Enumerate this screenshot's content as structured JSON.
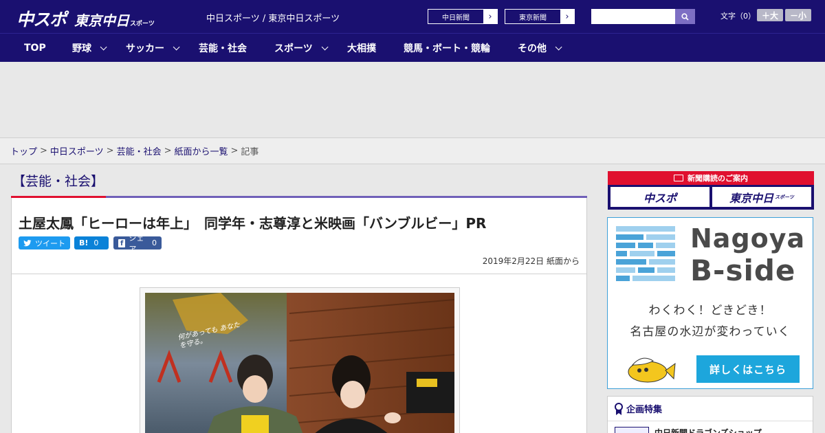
{
  "header": {
    "logo_main": "中スポ",
    "logo_sub": "東京中日",
    "logo_sub_small": "スポーツ",
    "site_title": "中日スポーツ / 東京中日スポーツ",
    "ext_links": [
      {
        "label": "中日新聞"
      },
      {
        "label": "東京新聞"
      }
    ],
    "search_placeholder": "",
    "font_size_label": "文字（0）",
    "font_plus": "＋大",
    "font_minus": "－小"
  },
  "nav": [
    {
      "label": "TOP",
      "dropdown": false
    },
    {
      "label": "野球",
      "dropdown": true
    },
    {
      "label": "サッカー",
      "dropdown": true
    },
    {
      "label": "芸能・社会",
      "dropdown": false
    },
    {
      "label": "スポーツ",
      "dropdown": true
    },
    {
      "label": "大相撲",
      "dropdown": false
    },
    {
      "label": "競馬・ボート・競輪",
      "dropdown": false
    },
    {
      "label": "その他",
      "dropdown": true
    }
  ],
  "breadcrumb": {
    "items": [
      "トップ",
      "中日スポーツ",
      "芸能・社会",
      "紙面から一覧"
    ],
    "current": "記事"
  },
  "article": {
    "category": "【芸能・社会】",
    "headline": "土屋太鳳「ヒーローは年上」　同学年・志尊淳と米映画「バンブルビー」PR",
    "share": {
      "tweet": "ツイート",
      "hatena_label": "B!",
      "hatena_count": "0",
      "fb_label": "シェア",
      "fb_count": "0"
    },
    "date": "2019年2月22日 紙面から",
    "photo_poster_text": "何があっても あなたを守る。"
  },
  "sidebar": {
    "subscription": {
      "title": "新聞購読のご案内",
      "left": "中スポ",
      "right": "東京中日",
      "right_small": "スポーツ"
    },
    "nagoya_ad": {
      "title_line1": "Nagoya",
      "title_line2": "B-side",
      "tagline1": "わくわく！どきどき！",
      "tagline2": "名古屋の水辺が変わっていく",
      "cta": "詳しくはこちら"
    },
    "feature": {
      "heading": "企画特集",
      "item": "中日新聞ドラゴンズショップ"
    }
  },
  "colors": {
    "navy": "#1a1070",
    "accent_red": "#e0102f",
    "accent_purple": "#7060b8",
    "twitter": "#1d9bf0",
    "hatena": "#0a82d8",
    "facebook": "#3a5a9a",
    "nagoya_blue": "#1da6dc"
  }
}
